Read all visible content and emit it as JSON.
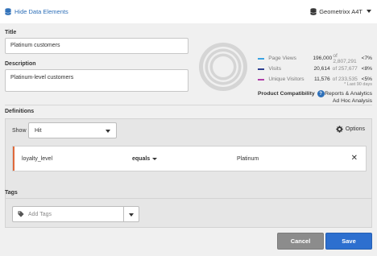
{
  "header": {
    "hide_label": "Hide Data Elements",
    "report_suite": "Geometrixx A4T"
  },
  "form": {
    "title_label": "Title",
    "title_value": "Platinum customers",
    "description_label": "Description",
    "description_value": "Platinum-level customers"
  },
  "metrics": [
    {
      "name": "Page Views",
      "count": "196,000",
      "total": "of 2,807,291",
      "pct": "<7%",
      "color": "#3aa3e3"
    },
    {
      "name": "Visits",
      "count": "20,614",
      "total": "of 257,677",
      "pct": "<8%",
      "color": "#2c3e8f"
    },
    {
      "name": "Unique Visitors",
      "count": "11,576",
      "total": "of 233,535",
      "pct": "<5%",
      "color": "#b03fa8"
    }
  ],
  "metrics_note": "* Last 90 days",
  "compatibility": {
    "label": "Product Compatibility",
    "line1": "Reports & Analytics",
    "line2": "Ad Hoc Analysis"
  },
  "definitions": {
    "label": "Definitions",
    "show_label": "Show",
    "container": "Hit",
    "options_label": "Options",
    "rule": {
      "dimension": "loyalty_level",
      "operator": "equals",
      "value": "Platinum"
    }
  },
  "tags": {
    "label": "Tags",
    "placeholder": "Add Tags"
  },
  "actions": {
    "cancel": "Cancel",
    "save": "Save"
  },
  "colors": {
    "accent": "#2d6fcf",
    "rule_handle": "#e06a3c"
  }
}
